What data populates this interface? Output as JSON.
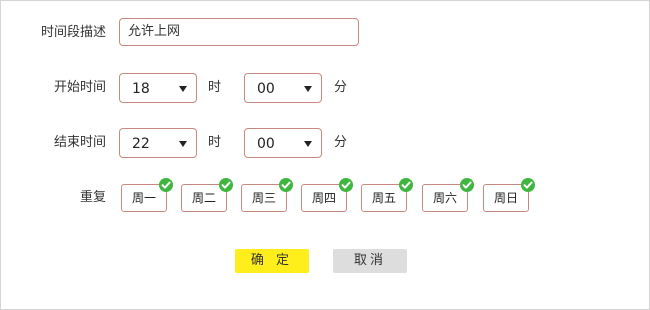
{
  "form": {
    "description": {
      "label": "时间段描述",
      "value": "允许上网"
    },
    "start": {
      "label": "开始时间",
      "hour": "18",
      "hour_unit": "时",
      "minute": "00",
      "minute_unit": "分"
    },
    "end": {
      "label": "结束时间",
      "hour": "22",
      "hour_unit": "时",
      "minute": "00",
      "minute_unit": "分"
    },
    "repeat": {
      "label": "重复",
      "days": [
        {
          "label": "周一",
          "checked": true
        },
        {
          "label": "周二",
          "checked": true
        },
        {
          "label": "周三",
          "checked": true
        },
        {
          "label": "周四",
          "checked": true
        },
        {
          "label": "周五",
          "checked": true
        },
        {
          "label": "周六",
          "checked": true
        },
        {
          "label": "周日",
          "checked": true
        }
      ]
    }
  },
  "buttons": {
    "confirm": "确 定",
    "cancel": "取消"
  },
  "colors": {
    "confirm_bg": "#ffee1c",
    "cancel_bg": "#dddddd",
    "check": "#3fb63f",
    "field_border": "#c88a80"
  },
  "icons": {
    "dropdown": "triangle-down-icon",
    "selected": "checkmark-circle-icon"
  }
}
